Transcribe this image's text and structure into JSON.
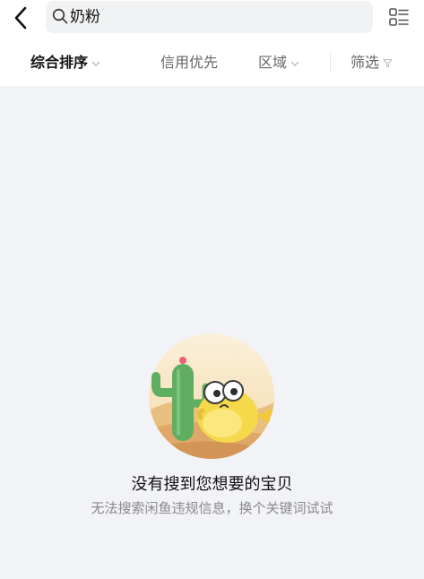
{
  "search": {
    "query": "奶粉"
  },
  "filters": [
    {
      "label": "综合排序",
      "active": true
    },
    {
      "label": "信用优先",
      "active": false
    },
    {
      "label": "区域",
      "active": false
    },
    {
      "label": "筛选",
      "active": false
    }
  ],
  "icons": {
    "back": "back-arrow-icon",
    "search": "search-icon",
    "layout": "list-layout-icon",
    "sort_dropdown": "chevron-down-icon",
    "region_dropdown": "chevron-down-icon",
    "filter": "funnel-icon"
  },
  "empty_state": {
    "title": "没有搜到您想要的宝贝",
    "subtitle": "无法搜索闲鱼违规信息，换个关键词试试"
  },
  "colors": {
    "page_bg": "#f2f3f7",
    "header_bg": "#ffffff",
    "search_bg": "#f1f2f4",
    "active_text": "#111111",
    "inactive_text": "#666666",
    "accent_yellow": "#f5d94a"
  }
}
